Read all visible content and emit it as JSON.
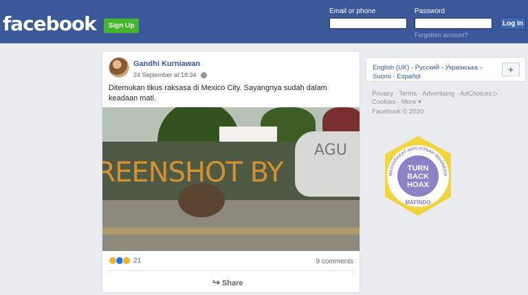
{
  "header": {
    "logo": "facebook",
    "signup_label": "Sign Up",
    "email_label": "Email or phone",
    "password_label": "Password",
    "forgot_label": "Forgotten account?",
    "login_label": "Log In"
  },
  "post": {
    "author": "Gandhi Kurniawan",
    "timestamp": "24 September at 18:34",
    "text": "Ditemukan tikus raksasa di Mexico City. Sayangnya sudah dalam keadaan mati.",
    "image_overlay_text": "AGU",
    "reaction_count": "21",
    "comments": "9 comments",
    "share_label": "Share"
  },
  "watermark": "SCREENSHOT BY",
  "sidebar": {
    "languages": "English (UK) · Русский · Українська · Suomi · Español",
    "plus_label": "+",
    "footer_links": "Privacy · Terms · Advertising · AdChoices ▷ · Cookies · More ▾",
    "copyright": "Facebook © 2020"
  },
  "badge": {
    "ring_text": "MASYARAKAT ANTI FITNAH INDONESIA",
    "center_top": "TURN",
    "center_mid": "BACK",
    "center_bottom": "HOAX",
    "org": "MAFINDO"
  },
  "colors": {
    "brand": "#3b5998",
    "signup": "#42b72a",
    "watermark": "#ffa528",
    "badge_purple": "#8a82c4",
    "badge_yellow": "#f2d53c"
  }
}
